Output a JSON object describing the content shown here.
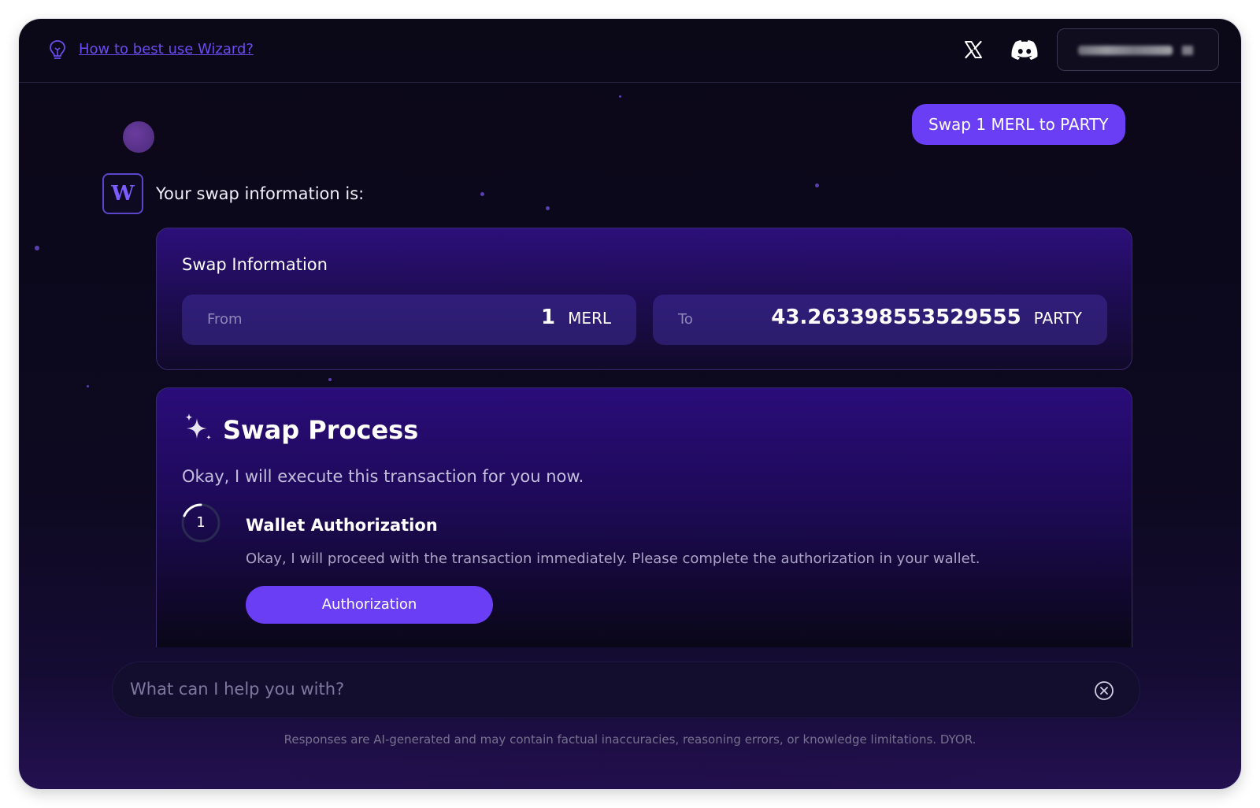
{
  "header": {
    "help_icon": "lightbulb-icon",
    "help_link": "How to best use Wizard?",
    "social": [
      "x-icon",
      "discord-icon"
    ],
    "wallet_label": "",
    "wallet_state": "redacted"
  },
  "chat": {
    "user_message": "Swap 1 MERL to PARTY",
    "bot_avatar_letter": "W",
    "bot_intro": "Your swap information is:"
  },
  "swap_info": {
    "title": "Swap Information",
    "from": {
      "label": "From",
      "amount": "1",
      "token": "MERL"
    },
    "to": {
      "label": "To",
      "amount": "43.263398553529555",
      "token": "PARTY"
    }
  },
  "swap_process": {
    "icon": "sparkle-icon",
    "title": "Swap Process",
    "text": "Okay, I will execute this transaction for you now.",
    "step": {
      "number": "1",
      "title": "Wallet Authorization",
      "text": "Okay, I will proceed with the transaction immediately. Please complete the authorization in your wallet.",
      "button": "Authorization"
    }
  },
  "input": {
    "placeholder": "What can I help you with?",
    "clear_icon": "close-circle-icon"
  },
  "disclaimer": "Responses are AI-generated and may contain factual inaccuracies, reasoning errors, or knowledge limitations. DYOR.",
  "colors": {
    "accent": "#6a3ef5",
    "link": "#6b4cf0",
    "background": "#0b0818"
  }
}
